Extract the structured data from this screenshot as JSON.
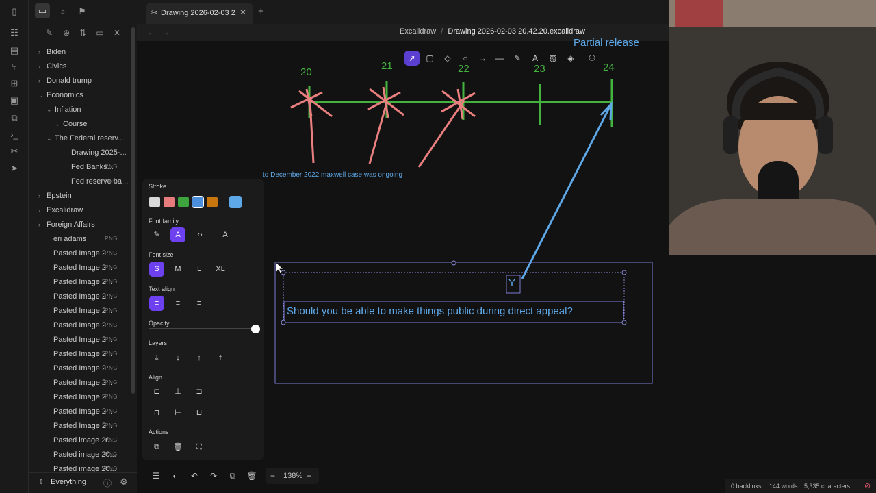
{
  "ribbon": {
    "icons": [
      "sidebar-toggle-icon",
      "file-explorer-icon",
      "search-icon",
      "bookmark-icon",
      "graph-icon",
      "daily-note-icon",
      "branch-icon",
      "canvas-icon",
      "calendar-icon",
      "copy-icon",
      "terminal-icon",
      "excalidraw-icon",
      "send-icon"
    ]
  },
  "tabs": [
    {
      "title": "Drawing 2026-02-03 2...",
      "icon": "excalidraw-icon"
    }
  ],
  "breadcrumb": {
    "parent": "Excalidraw",
    "separator": "/",
    "current": "Drawing 2026-02-03 20.42.20.excalidraw"
  },
  "sidebar": {
    "tree": [
      {
        "label": "Biden",
        "chev": "›",
        "ext": ""
      },
      {
        "label": "Civics",
        "chev": "›",
        "ext": ""
      },
      {
        "label": "Donald trump",
        "chev": "›",
        "ext": ""
      },
      {
        "label": "Economics",
        "chev": "⌄",
        "ext": ""
      },
      {
        "label": "Inflation",
        "chev": "⌄",
        "ext": ""
      },
      {
        "label": "Course",
        "chev": "⌄",
        "ext": ""
      },
      {
        "label": "The Federal reserv...",
        "chev": "⌄",
        "ext": ""
      },
      {
        "label": "Drawing 2025-...",
        "chev": "",
        "ext": ""
      },
      {
        "label": "Fed Banks...",
        "chev": "",
        "ext": "PNG"
      },
      {
        "label": "Fed reserve ba...",
        "chev": "",
        "ext": "PNG"
      },
      {
        "label": "Epstein",
        "chev": "›",
        "ext": ""
      },
      {
        "label": "Excalidraw",
        "chev": "›",
        "ext": ""
      },
      {
        "label": "Foreign Affairs",
        "chev": "›",
        "ext": ""
      },
      {
        "label": "eri adams",
        "chev": "",
        "ext": "PNG"
      },
      {
        "label": "Pasted Image 2...",
        "chev": "",
        "ext": "PNG"
      },
      {
        "label": "Pasted Image 2...",
        "chev": "",
        "ext": "PNG"
      },
      {
        "label": "Pasted Image 2...",
        "chev": "",
        "ext": "PNG"
      },
      {
        "label": "Pasted Image 2...",
        "chev": "",
        "ext": "PNG"
      },
      {
        "label": "Pasted Image 2...",
        "chev": "",
        "ext": "PNG"
      },
      {
        "label": "Pasted Image 2...",
        "chev": "",
        "ext": "PNG"
      },
      {
        "label": "Pasted Image 2...",
        "chev": "",
        "ext": "PNG"
      },
      {
        "label": "Pasted Image 2...",
        "chev": "",
        "ext": "PNG"
      },
      {
        "label": "Pasted Image 2...",
        "chev": "",
        "ext": "PNG"
      },
      {
        "label": "Pasted Image 2...",
        "chev": "",
        "ext": "PNG"
      },
      {
        "label": "Pasted Image 2...",
        "chev": "",
        "ext": "PNG"
      },
      {
        "label": "Pasted Image 2...",
        "chev": "",
        "ext": "PNG"
      },
      {
        "label": "Pasted Image 2...",
        "chev": "",
        "ext": "PNG"
      },
      {
        "label": "Pasted image 20...",
        "chev": "",
        "ext": "PNG"
      },
      {
        "label": "Pasted image 20...",
        "chev": "",
        "ext": "PNG"
      },
      {
        "label": "Pasted image 20...",
        "chev": "",
        "ext": "PNG"
      }
    ],
    "vault_name": "Everything"
  },
  "props": {
    "stroke_label": "Stroke",
    "stroke_colors": [
      "#d9d9d9",
      "#e87b7b",
      "#3ea53e",
      "#4b8fdc",
      "#c8760d"
    ],
    "stroke_current": "#5fa8e8",
    "font_family_label": "Font family",
    "font_size_label": "Font size",
    "font_sizes": [
      "S",
      "M",
      "L",
      "XL"
    ],
    "text_align_label": "Text align",
    "opacity_label": "Opacity",
    "opacity_value": 1.0,
    "layers_label": "Layers",
    "align_label": "Align",
    "actions_label": "Actions"
  },
  "canvas": {
    "annotation": "to December 2022 maxwell case was ongoing",
    "partial_release": "Partial release",
    "timeline_labels": [
      "20",
      "21",
      "22",
      "23",
      "24"
    ],
    "text_box": "Should you be able to make things public during direct appeal?",
    "y_label": "Y",
    "colors": {
      "green": "#43b23f",
      "red": "#ea7f7f",
      "blue": "#5fa8e8",
      "selection": "#7c7cd6"
    }
  },
  "zoom": {
    "minus": "−",
    "value": "138%",
    "plus": "+"
  },
  "status": {
    "backlinks": "0 backlinks",
    "words": "144 words",
    "characters": "5,335 characters"
  }
}
